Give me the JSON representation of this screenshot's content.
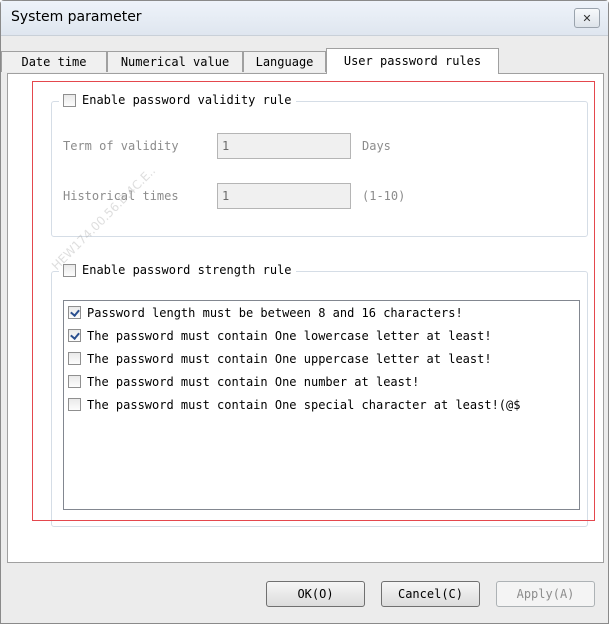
{
  "window": {
    "title": "System parameter"
  },
  "tabs": [
    {
      "label": "Date time"
    },
    {
      "label": "Numerical value"
    },
    {
      "label": "Language"
    },
    {
      "label": "User password rules"
    }
  ],
  "validity": {
    "checkbox_label": "Enable password validity rule",
    "enabled": false,
    "term_label": "Term of validity",
    "term_value": "1",
    "term_unit": "Days",
    "history_label": "Historical times",
    "history_value": "1",
    "history_range": "(1-10)"
  },
  "strength": {
    "checkbox_label": "Enable password strength rule",
    "enabled": false,
    "rules": [
      {
        "label": "Password length must be between 8 and 16 characters!",
        "checked": true
      },
      {
        "label": "The password must contain One lowercase letter at least!",
        "checked": true
      },
      {
        "label": "The password must contain One uppercase letter at least!",
        "checked": false
      },
      {
        "label": "The password must contain One number at least!",
        "checked": false
      },
      {
        "label": "The password must contain One special character at least!(@$",
        "checked": false
      }
    ]
  },
  "buttons": {
    "ok": "OK(O)",
    "cancel": "Cancel(C)",
    "apply": "Apply(A)"
  },
  "watermark": "HEW174.00.56.B.4C.E.."
}
